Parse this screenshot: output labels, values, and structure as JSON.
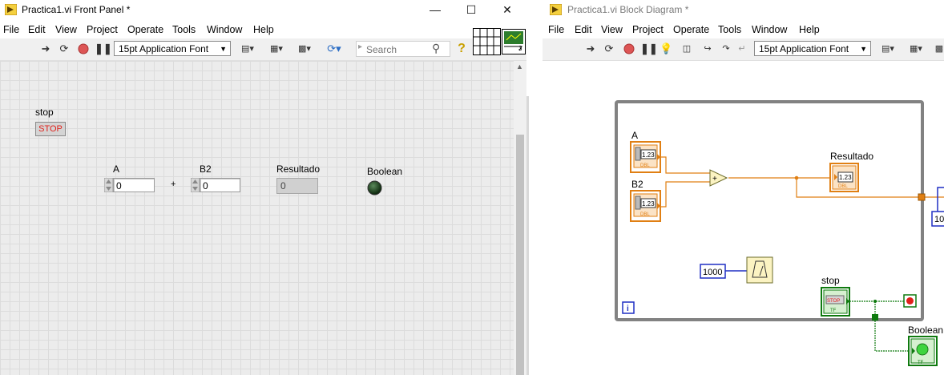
{
  "front_panel": {
    "title": "Practica1.vi Front Panel *",
    "menu": [
      "File",
      "Edit",
      "View",
      "Project",
      "Operate",
      "Tools",
      "Window",
      "Help"
    ],
    "font_selector": "15pt Application Font",
    "search_placeholder": "Search",
    "stop": {
      "label": "stop",
      "button_text": "STOP"
    },
    "control_a": {
      "label": "A",
      "value": "0"
    },
    "operator": "+",
    "control_b2": {
      "label": "B2",
      "value": "0"
    },
    "indicator_resultado": {
      "label": "Resultado",
      "value": "0"
    },
    "led_boolean": {
      "label": "Boolean"
    },
    "connector_badge": "3"
  },
  "block_diagram": {
    "title": "Practica1.vi Block Diagram *",
    "menu": [
      "File",
      "Edit",
      "View",
      "Project",
      "Operate",
      "Tools",
      "Window",
      "Help"
    ],
    "font_selector": "15pt Application Font",
    "labels": {
      "a": "A",
      "b2": "B2",
      "resultado": "Resultado",
      "stop": "stop",
      "boolean": "Boolean",
      "constant": "1000",
      "iteration": "i",
      "partial_constant": "10",
      "add_symbol": "+",
      "numeric_glyph": "1.23",
      "dbl_tag": "DBL",
      "stop_glyph": "STOP",
      "tf_tag": "TF"
    }
  },
  "colors": {
    "numeric_wire": "#e07f13",
    "boolean_wire": "#0f7a0f",
    "integer_constant": "#1f2fc4",
    "while_loop": "#828282"
  }
}
